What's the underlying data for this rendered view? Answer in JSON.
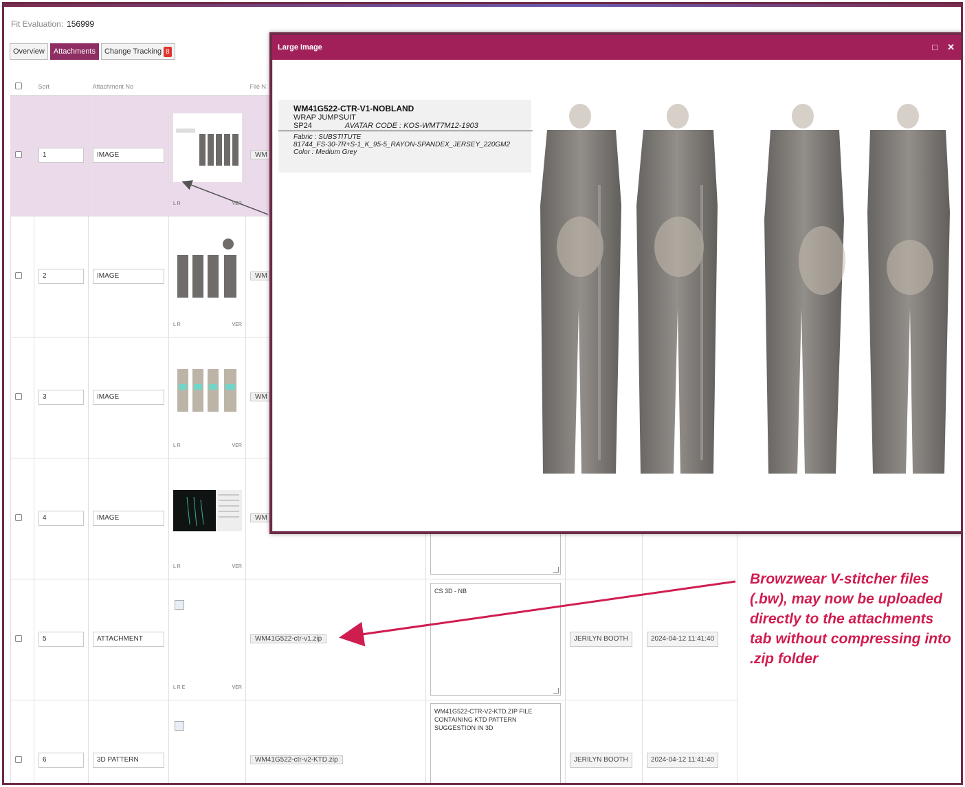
{
  "page": {
    "title_label": "Fit Evaluation:",
    "title_value": "156999"
  },
  "tabs": [
    {
      "label": "Overview"
    },
    {
      "label": "Attachments"
    },
    {
      "label": "Change Tracking",
      "badge": "8"
    }
  ],
  "table": {
    "headers": {
      "sort": "Sort",
      "attachment_no": "Attachment No",
      "file_name": "File N"
    },
    "rows": [
      {
        "sort": "1",
        "type": "IMAGE",
        "file": "WM",
        "desc": "",
        "user": "",
        "date": "",
        "caption_left": "L R",
        "caption_right": "VER"
      },
      {
        "sort": "2",
        "type": "IMAGE",
        "file": "WM",
        "desc": "",
        "user": "",
        "date": "",
        "caption_left": "L R",
        "caption_right": "VER"
      },
      {
        "sort": "3",
        "type": "IMAGE",
        "file": "WM",
        "desc": "",
        "user": "",
        "date": "",
        "caption_left": "L R",
        "caption_right": "VER"
      },
      {
        "sort": "4",
        "type": "IMAGE",
        "file": "WM",
        "desc": "",
        "user": "",
        "date": "",
        "caption_left": "L R",
        "caption_right": "VER"
      },
      {
        "sort": "5",
        "type": "ATTACHMENT",
        "file": "WM41G522-ctr-v1.zip",
        "desc": "CS 3D - NB",
        "user": "JERILYN BOOTH",
        "date": "2024-04-12 11:41:40",
        "caption_left": "L R E",
        "caption_right": "VER"
      },
      {
        "sort": "6",
        "type": "3D PATTERN",
        "file": "WM41G522-ctr-v2-KTD.zip",
        "desc": "WM41G522-CTR-V2-KTD.ZIP FILE CONTAINING KTD PATTERN SUGGESTION IN 3D",
        "user": "JERILYN BOOTH",
        "date": "2024-04-12 11:41:40",
        "caption_left": "",
        "caption_right": ""
      }
    ]
  },
  "modal": {
    "title": "Large Image",
    "info": {
      "code": "WM41G522-CTR-V1-NOBLAND",
      "style": "WRAP JUMPSUIT",
      "season": "SP24",
      "avatar": "AVATAR CODE : KOS-WMT7M12-1903",
      "fabric": "Fabric : SUBSTITUTE",
      "fabric_detail": "81744_FS-30-7R+S-1_K_95-5_RAYON-SPANDEX_JERSEY_220GM2",
      "color": "Color : Medium Grey"
    }
  },
  "annotation": {
    "text": "Browzwear V-stitcher files (.bw), may now be uploaded directly to the attachments tab without compressing into .zip folder",
    "color": "#d01d4f"
  },
  "colors": {
    "accent": "#8e2e63",
    "modal_header": "#a2205a",
    "border": "#6e2a47",
    "selected_row": "#ebdbea"
  }
}
